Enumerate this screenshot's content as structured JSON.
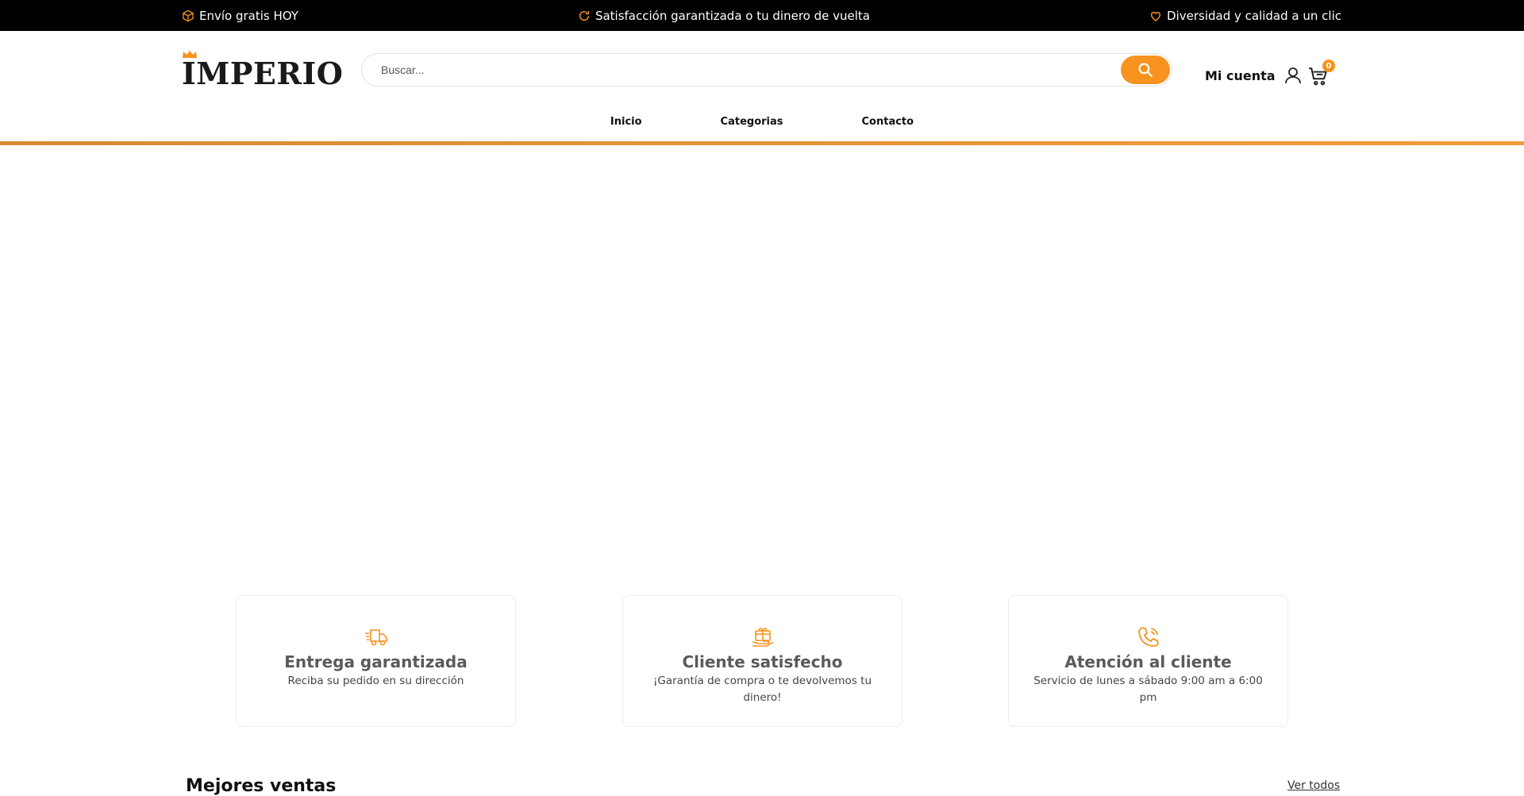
{
  "topbar": {
    "promos": [
      {
        "icon": "box-icon",
        "text": "Envío gratis HOY"
      },
      {
        "icon": "refresh-icon",
        "text": "Satisfacción garantizada o tu dinero de vuelta"
      },
      {
        "icon": "heart-icon",
        "text": "Diversidad y calidad a un clic"
      }
    ]
  },
  "header": {
    "logo_text": "IMPERIO",
    "search": {
      "placeholder": "Buscar..."
    },
    "account_label": "Mi cuenta",
    "cart_count": "0"
  },
  "nav": {
    "items": [
      {
        "label": "Inicio"
      },
      {
        "label": "Categorias"
      },
      {
        "label": "Contacto"
      }
    ]
  },
  "features": [
    {
      "icon": "delivery-truck-icon",
      "title": "Entrega garantizada",
      "text": "Reciba su pedido en su dirección"
    },
    {
      "icon": "gift-hand-icon",
      "title": "Cliente satisfecho",
      "text": "¡Garantía de compra o te devolvemos tu dinero!"
    },
    {
      "icon": "phone-icon",
      "title": "Atención al cliente",
      "text": "Servicio de lunes a sábado 9:00 am a 6:00 pm"
    }
  ],
  "best_sellers": {
    "title": "Mejores ventas",
    "see_all": "Ver todos"
  },
  "colors": {
    "accent": "#f7931e",
    "topbar_bg": "#000000"
  }
}
